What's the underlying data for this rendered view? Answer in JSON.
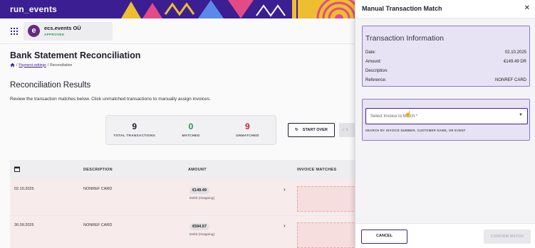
{
  "brand": {
    "logo_main": "run",
    "logo_dot": "_",
    "logo_tail": "events",
    "banner_color": "#3e1f96",
    "accent": "#f2c230"
  },
  "org": {
    "initial": "e",
    "name": "ecs.events OÜ",
    "status": "APPROVED"
  },
  "page": {
    "title": "Bank Statement Reconciliation",
    "breadcrumb": [
      "Payment settings",
      "/",
      "Reconciliation"
    ]
  },
  "results": {
    "title": "Reconciliation Results",
    "description": "Review the transaction matches below. Click unmatched transactions to manually assign invoices.",
    "stats": [
      {
        "value": "9",
        "label": "TOTAL TRANSACTIONS"
      },
      {
        "value": "0",
        "label": "MATCHED"
      },
      {
        "value": "9",
        "label": "UNMATCHED"
      }
    ],
    "start_over_label": "START OVER",
    "ghost_label": "S"
  },
  "table": {
    "headers": [
      "DESCRIPTION",
      "AMOUNT",
      "INVOICE MATCHES"
    ],
    "rows": [
      {
        "date": "02.10.2025",
        "description": "NONREF CARD",
        "amount": "€149.49",
        "amount_type": "Debit (Outgoing)"
      },
      {
        "date": "30.09.2025",
        "description": "NONREF CARD",
        "amount": "€594.57",
        "amount_type": "Debit (Outgoing)"
      }
    ]
  },
  "modal": {
    "title": "Manual Transaction Match",
    "info": {
      "title": "Transaction Information",
      "rows": [
        {
          "label": "Date:",
          "value": "02.10.2025"
        },
        {
          "label": "Amount:",
          "value": "€149.49 DR"
        },
        {
          "label": "Description:",
          "value": ""
        },
        {
          "label": "Reference:",
          "value": "NONREF CARD"
        }
      ]
    },
    "select": {
      "placeholder": "Select Invoice to Match *",
      "help": "SEARCH BY INVOICE NUMBER, CUSTOMER NAME, OR EVENT"
    },
    "cancel_label": "CANCEL",
    "confirm_label": "CONFIRM MATCH"
  }
}
